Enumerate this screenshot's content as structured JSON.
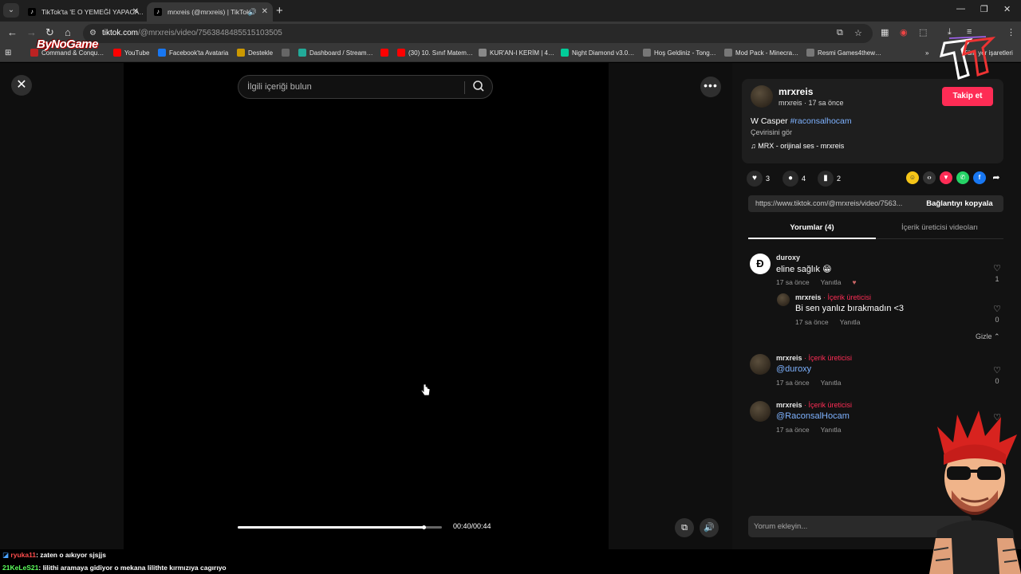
{
  "browser": {
    "tabs": [
      {
        "title": "TikTok'ta 'E O YEMEĞİ YAPACA…",
        "active": false
      },
      {
        "title": "mrxreis (@mrxreis) | TikTok",
        "active": true
      }
    ],
    "url_host": "tiktok.com",
    "url_path": "/@mrxreis/video/7563848485515103505",
    "bookmarks": [
      "Command & Conqu…",
      "YouTube",
      "Facebook'ta Avataria",
      "Destekle",
      "Dashboard / Stream…",
      "(30) 10. Sınıf Matem…",
      "KUR'AN-I KERİM | 4…",
      "Night Diamond v3.0…",
      "Hoş Geldiniz - Tong…",
      "Mod Pack - Minecra…",
      "Resmi Games4thew…",
      "Tüm yer işaretleri"
    ]
  },
  "player": {
    "search_placeholder": "İlgili içeriği bulun",
    "time": "00:40/00:44",
    "progress": 0.91
  },
  "post": {
    "username": "mrxreis",
    "meta": "mrxreis · 17 sa önce",
    "follow_label": "Takip et",
    "caption_text": "W Casper ",
    "caption_tag": "#raconsalhocam",
    "see_translation": "Çevirisini gör",
    "music": "MRX - orijinal ses - mrxreis",
    "likes": "3",
    "comments": "4",
    "saves": "2",
    "link": "https://www.tiktok.com/@mrxreis/video/7563...",
    "copy_label": "Bağlantıyı kopyala"
  },
  "tabs": {
    "comments": "Yorumlar (4)",
    "creator_videos": "İçerik üreticisi videoları"
  },
  "comments": [
    {
      "user": "duroxy",
      "text": "eline sağlık 😁",
      "time": "17 sa önce",
      "reply": "Yanıtla",
      "likes": "1"
    },
    {
      "user": "mrxreis",
      "badge": " · İçerik üreticisi",
      "text": "Bi sen yanlız bırakmadın <3",
      "time": "17 sa önce",
      "reply": "Yanıtla",
      "likes": "0"
    },
    {
      "user": "mrxreis",
      "badge": " · İçerik üreticisi",
      "text": "@duroxy",
      "time": "17 sa önce",
      "reply": "Yanıtla",
      "likes": "0"
    },
    {
      "user": "mrxreis",
      "badge": " · İçerik üreticisi",
      "text": "@RaconsalHocam",
      "time": "17 sa önce",
      "reply": "Yanıtla",
      "likes": "0"
    }
  ],
  "hide_label": "Gizle",
  "comment_placeholder": "Yorum ekleyin...",
  "overlay": {
    "logo": "ByNoGame",
    "chat": [
      {
        "user": "ryuka11",
        "msg": ": zaten o aıkıyor sjsjjs",
        "color": "#ff4d4d"
      },
      {
        "user": "21KeLeS21",
        "msg": ": lilithi aramaya gidiyor o mekana lilithte kırmızıya cagırıyo",
        "color": "#5cff5c"
      }
    ]
  },
  "colors": {
    "accent": "#fe2c55",
    "link": "#7eb2ff"
  }
}
